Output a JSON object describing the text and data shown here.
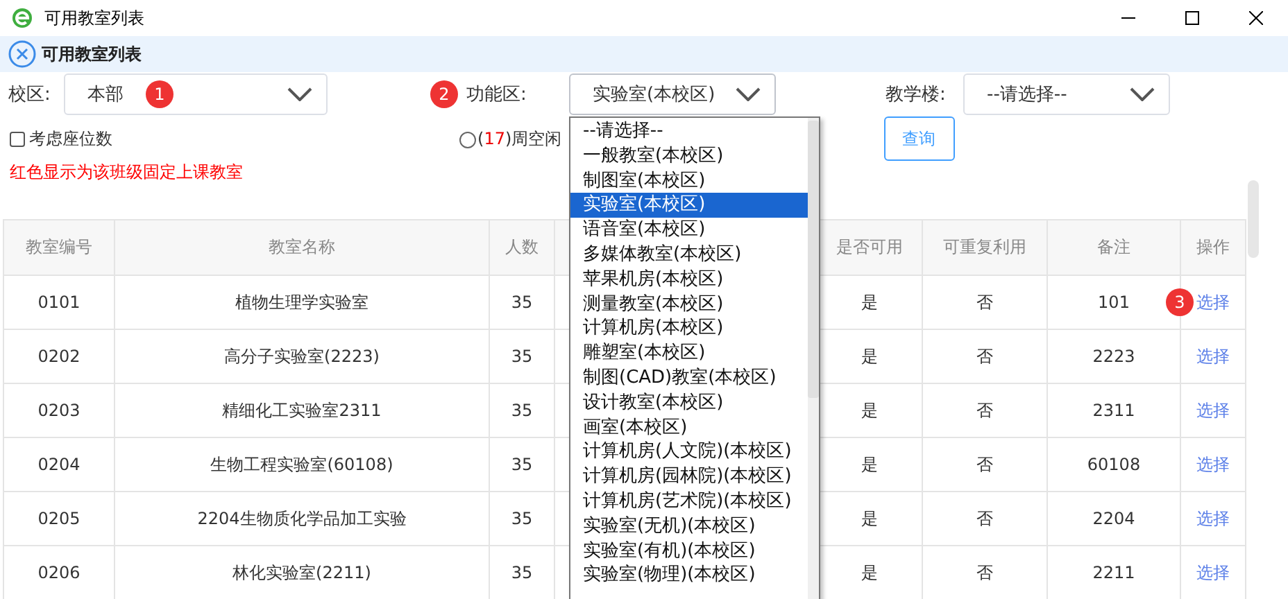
{
  "window": {
    "title": "可用教室列表"
  },
  "tab": {
    "title": "可用教室列表"
  },
  "filters": {
    "campus": {
      "label": "校区:",
      "value": "本部",
      "badge": "1"
    },
    "function_area": {
      "badge": "2",
      "label": "功能区:",
      "value": "实验室(本校区)",
      "expanded": true
    },
    "building": {
      "label": "教学楼:",
      "value": "--请选择--"
    },
    "seat_checkbox": {
      "label": "考虑座位数",
      "checked": false
    },
    "week_radio": {
      "prefix": "(",
      "count": "17",
      "suffix": ")周空闲",
      "selected": false
    },
    "query_button": "查询"
  },
  "note": "红色显示为该班级固定上课教室",
  "dropdown_options": [
    {
      "label": "--请选择--",
      "selected": false
    },
    {
      "label": "一般教室(本校区)",
      "selected": false
    },
    {
      "label": "制图室(本校区)",
      "selected": false
    },
    {
      "label": "实验室(本校区)",
      "selected": true
    },
    {
      "label": "语音室(本校区)",
      "selected": false
    },
    {
      "label": "多媒体教室(本校区)",
      "selected": false
    },
    {
      "label": "苹果机房(本校区)",
      "selected": false
    },
    {
      "label": "测量教室(本校区)",
      "selected": false
    },
    {
      "label": "计算机房(本校区)",
      "selected": false
    },
    {
      "label": "雕塑室(本校区)",
      "selected": false
    },
    {
      "label": "制图(CAD)教室(本校区)",
      "selected": false
    },
    {
      "label": "设计教室(本校区)",
      "selected": false
    },
    {
      "label": "画室(本校区)",
      "selected": false
    },
    {
      "label": "计算机房(人文院)(本校区)",
      "selected": false
    },
    {
      "label": "计算机房(园林院)(本校区)",
      "selected": false
    },
    {
      "label": "计算机房(艺术院)(本校区)",
      "selected": false
    },
    {
      "label": "实验室(无机)(本校区)",
      "selected": false
    },
    {
      "label": "实验室(有机)(本校区)",
      "selected": false
    },
    {
      "label": "实验室(物理)(本校区)",
      "selected": false
    }
  ],
  "table": {
    "columns": [
      "教室编号",
      "教室名称",
      "人数",
      "是否可用",
      "可重复利用",
      "备注",
      "操作"
    ],
    "row_badge": "3",
    "rows": [
      [
        "0101",
        "植物生理学实验室",
        "35",
        "是",
        "否",
        "101",
        "选择"
      ],
      [
        "0202",
        "高分子实验室(2223)",
        "35",
        "是",
        "否",
        "2223",
        "选择"
      ],
      [
        "0203",
        "精细化工实验室2311",
        "35",
        "是",
        "否",
        "2311",
        "选择"
      ],
      [
        "0204",
        "生物工程实验室(60108)",
        "35",
        "是",
        "否",
        "60108",
        "选择"
      ],
      [
        "0205",
        "2204生物质化学品加工实验",
        "35",
        "是",
        "否",
        "2204",
        "选择"
      ],
      [
        "0206",
        "林化实验室(2211)",
        "35",
        "是",
        "否",
        "2211",
        "选择"
      ]
    ]
  }
}
